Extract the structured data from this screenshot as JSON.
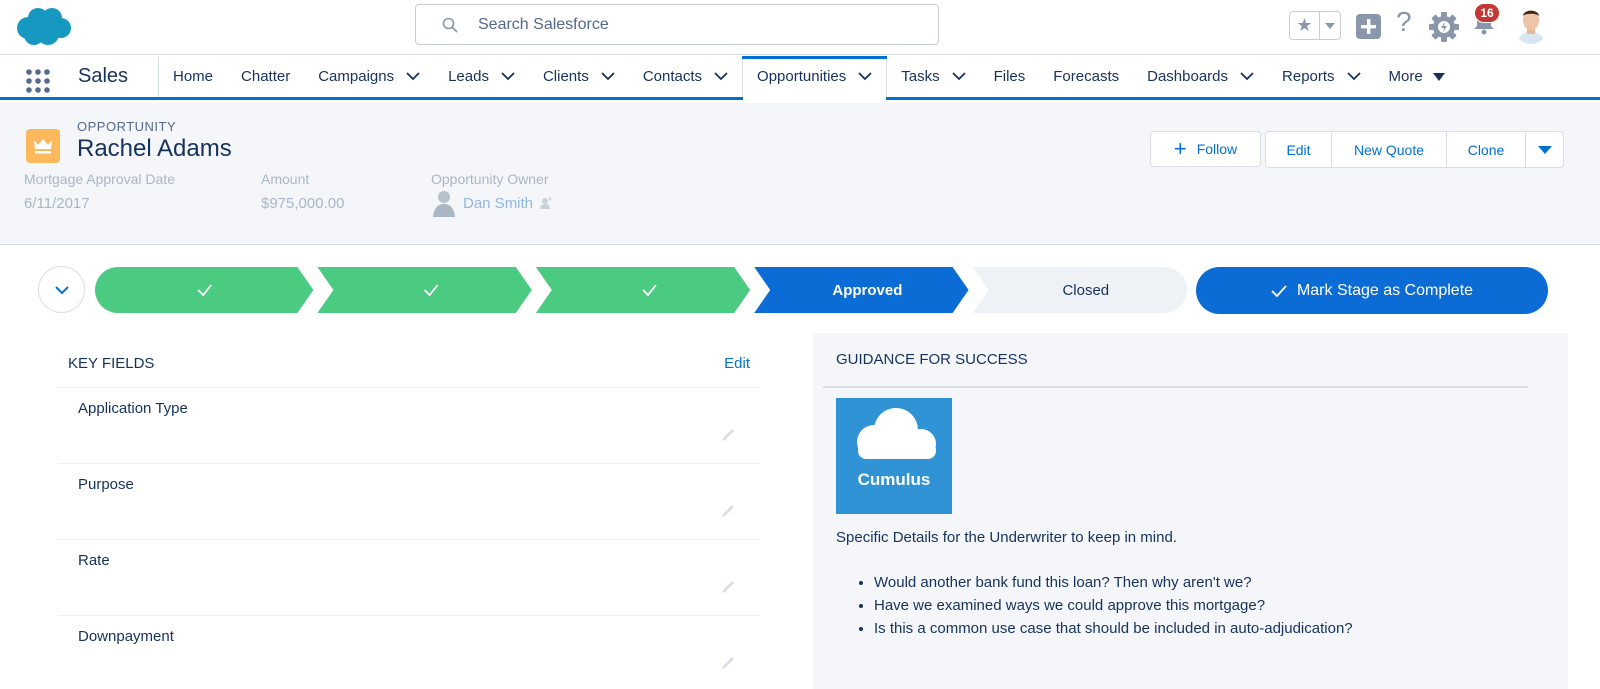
{
  "header": {
    "search_placeholder": "Search Salesforce",
    "notification_count": "16",
    "icons": [
      "salesforce-logo",
      "search-icon",
      "favorites-star-icon",
      "add-icon",
      "help-icon",
      "setup-gear-icon",
      "notification-bell-icon",
      "user-avatar"
    ]
  },
  "nav": {
    "app_name": "Sales",
    "items": [
      {
        "label": "Home",
        "dropdown": false
      },
      {
        "label": "Chatter",
        "dropdown": false
      },
      {
        "label": "Campaigns",
        "dropdown": true
      },
      {
        "label": "Leads",
        "dropdown": true
      },
      {
        "label": "Clients",
        "dropdown": true
      },
      {
        "label": "Contacts",
        "dropdown": true
      },
      {
        "label": "Opportunities",
        "dropdown": true,
        "active": true
      },
      {
        "label": "Tasks",
        "dropdown": true
      },
      {
        "label": "Files",
        "dropdown": false
      },
      {
        "label": "Forecasts",
        "dropdown": false
      },
      {
        "label": "Dashboards",
        "dropdown": true
      },
      {
        "label": "Reports",
        "dropdown": true
      }
    ],
    "more_label": "More"
  },
  "record": {
    "type": "OPPORTUNITY",
    "title": "Rachel Adams",
    "fields": [
      {
        "label": "Mortgage Approval Date",
        "value": "6/11/2017"
      },
      {
        "label": "Amount",
        "value": "$975,000.00"
      },
      {
        "label": "Opportunity Owner",
        "value": "Dan Smith"
      }
    ],
    "actions": {
      "follow": "Follow",
      "edit": "Edit",
      "new_quote": "New Quote",
      "clone": "Clone"
    }
  },
  "path": {
    "stages": [
      {
        "label": "",
        "status": "complete"
      },
      {
        "label": "",
        "status": "complete"
      },
      {
        "label": "",
        "status": "complete"
      },
      {
        "label": "Approved",
        "status": "current"
      },
      {
        "label": "Closed",
        "status": "incomplete"
      }
    ],
    "mark_complete_label": "Mark Stage as Complete",
    "colors": {
      "complete": "#4bca81",
      "current": "#0b6cd6",
      "incomplete": "#eef1f6"
    }
  },
  "key_fields": {
    "title": "KEY FIELDS",
    "edit_label": "Edit",
    "fields": [
      {
        "label": "Application Type",
        "value": ""
      },
      {
        "label": "Purpose",
        "value": ""
      },
      {
        "label": "Rate",
        "value": ""
      },
      {
        "label": "Downpayment",
        "value": ""
      }
    ]
  },
  "guidance": {
    "title": "GUIDANCE FOR SUCCESS",
    "logo_text": "Cumulus",
    "intro": "Specific Details for the Underwriter to keep in mind.",
    "bullets": [
      "Would another bank fund this loan? Then why aren't we?",
      "Have we examined ways we could approve this mortgage?",
      "Is this a common use case that should be included in auto-adjudication?"
    ]
  }
}
